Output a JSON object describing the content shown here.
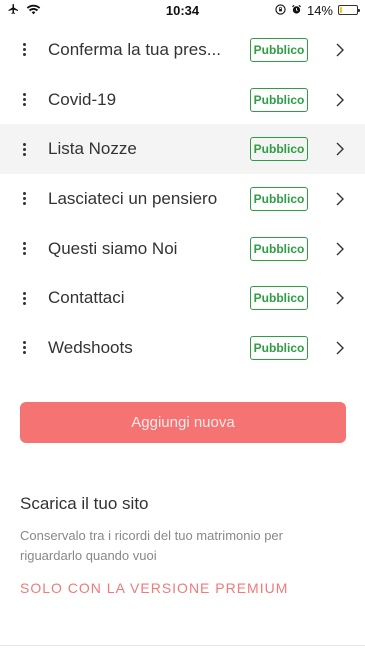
{
  "status_bar": {
    "time": "10:34",
    "battery_text": "14%",
    "battery_level": 0.14,
    "icons": [
      "airplane-icon",
      "wifi-icon",
      "lock-rotation-icon",
      "alarm-icon",
      "battery-icon"
    ]
  },
  "pages": [
    {
      "title": "Conferma la tua pres...",
      "status": "Pubblico"
    },
    {
      "title": "Covid-19",
      "status": "Pubblico"
    },
    {
      "title": "Lista Nozze",
      "status": "Pubblico",
      "highlighted": true
    },
    {
      "title": "Lasciateci un pensiero",
      "status": "Pubblico"
    },
    {
      "title": "Questi siamo Noi",
      "status": "Pubblico"
    },
    {
      "title": "Contattaci",
      "status": "Pubblico"
    },
    {
      "title": "Wedshoots",
      "status": "Pubblico"
    }
  ],
  "add_button": {
    "label": "Aggiungi nuova"
  },
  "download": {
    "title": "Scarica il tuo sito",
    "description": "Conservalo tra i ricordi del tuo matrimonio per riguardarlo quando vuoi",
    "premium_label": "SOLO CON LA VERSIONE PREMIUM"
  },
  "colors": {
    "accent": "#f57373",
    "badge": "#2e9d44",
    "premium_text": "#f07a7a"
  }
}
